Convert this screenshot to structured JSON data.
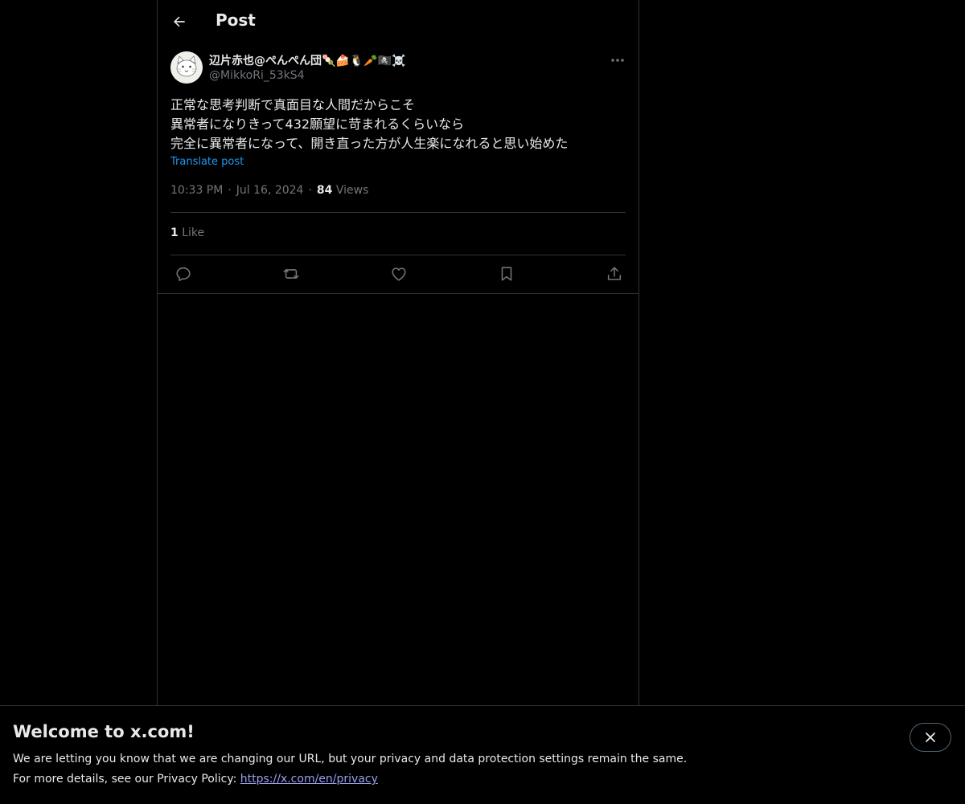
{
  "header": {
    "title": "Post",
    "back_icon": "arrow-left-icon"
  },
  "author": {
    "display_name": "辺片赤也@ぺんぺん団🍡🍰🐧🥕🏴‍☠️☠️",
    "handle": "@MikkoRi_53kS4"
  },
  "post": {
    "lines": [
      "正常な思考判断で真面目な人間だからこそ",
      "異常者になりきって432願望に苛まれるくらいなら",
      "完全に異常者になって、開き直った方が人生楽になれると思い始めた"
    ],
    "translate_label": "Translate post",
    "time": "10:33 PM",
    "date": "Jul 16, 2024",
    "views_count": "84",
    "views_label": "Views",
    "likes_count": "1",
    "likes_label": "Like"
  },
  "actions": [
    "reply-icon",
    "repost-icon",
    "like-icon",
    "bookmark-icon",
    "share-icon"
  ],
  "banner": {
    "title": "Welcome to x.com!",
    "line1": "We are letting you know that we are changing our URL, but your privacy and data protection settings remain the same.",
    "line2_prefix": "For more details, see our Privacy Policy: ",
    "link": "https://x.com/en/privacy"
  },
  "colors": {
    "background": "#000000",
    "text": "#e7e9ea",
    "muted": "#71767b",
    "accent": "#1d9bf0",
    "border": "#2f3336"
  }
}
